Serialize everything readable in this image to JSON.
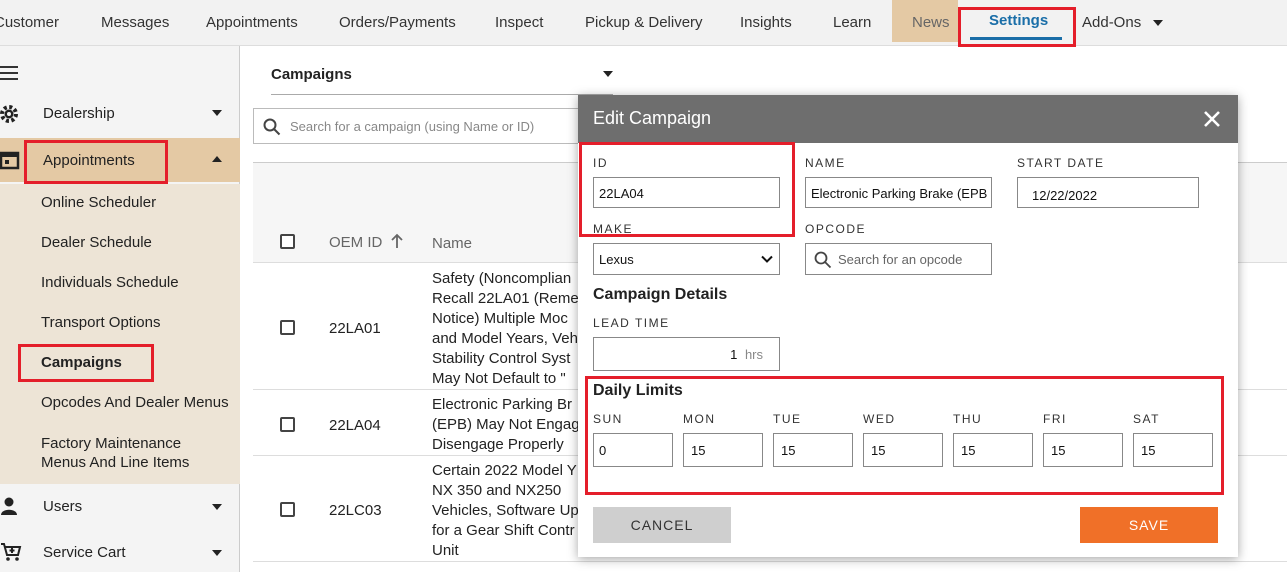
{
  "nav": {
    "items": [
      "Customer",
      "Messages",
      "Appointments",
      "Orders/Payments",
      "Inspect",
      "Pickup & Delivery",
      "Insights",
      "Learn",
      "News",
      "Settings",
      "Add-Ons"
    ]
  },
  "sidebar": {
    "sections": [
      "Dealership",
      "Appointments",
      "Users",
      "Service Cart"
    ],
    "sub_items": [
      "Online Scheduler",
      "Dealer Schedule",
      "Individuals Schedule",
      "Transport Options",
      "Campaigns",
      "Opcodes And Dealer Menus",
      "Factory Maintenance Menus And Line Items"
    ]
  },
  "main": {
    "select_value": "Campaigns",
    "search_placeholder": "Search for a campaign (using Name or ID)",
    "columns": [
      "OEM ID",
      "Name"
    ],
    "rows": [
      {
        "id": "22LA01",
        "name_lines": [
          "Safety (Noncomplian",
          "Recall 22LA01 (Reme",
          "Notice) Multiple Moc",
          "and Model Years, Veh",
          "Stability Control Syst",
          "May Not Default to \""
        ]
      },
      {
        "id": "22LA04",
        "name_lines": [
          "Electronic Parking Br",
          "(EPB) May Not Engag",
          "Disengage Properly"
        ]
      },
      {
        "id": "22LC03",
        "name_lines": [
          "Certain 2022 Model Y",
          "NX 350 and NX250",
          "Vehicles, Software Up",
          "for a Gear Shift Contr",
          "Unit"
        ]
      }
    ]
  },
  "modal": {
    "title": "Edit Campaign",
    "labels": {
      "id": "ID",
      "name": "NAME",
      "start_date": "START DATE",
      "make": "MAKE",
      "opcode": "OPCODE",
      "lead_time": "LEAD TIME"
    },
    "values": {
      "id": "22LA04",
      "name": "Electronic Parking Brake (EPB",
      "start_date": "12/22/2022",
      "make": "Lexus",
      "lead_time": "1",
      "lead_unit": "hrs"
    },
    "opcode_placeholder": "Search for an opcode",
    "campaign_details_title": "Campaign Details",
    "daily_limits_title": "Daily Limits",
    "days": [
      {
        "label": "SUN",
        "value": "0"
      },
      {
        "label": "MON",
        "value": "15"
      },
      {
        "label": "TUE",
        "value": "15"
      },
      {
        "label": "WED",
        "value": "15"
      },
      {
        "label": "THU",
        "value": "15"
      },
      {
        "label": "FRI",
        "value": "15"
      },
      {
        "label": "SAT",
        "value": "15"
      }
    ],
    "cancel_label": "CANCEL",
    "save_label": "SAVE"
  },
  "colors": {
    "accent_blue": "#1a6ea8",
    "highlight_red": "#e41e2a",
    "save_orange": "#f07028",
    "active_tan": "#e4c9a4"
  }
}
